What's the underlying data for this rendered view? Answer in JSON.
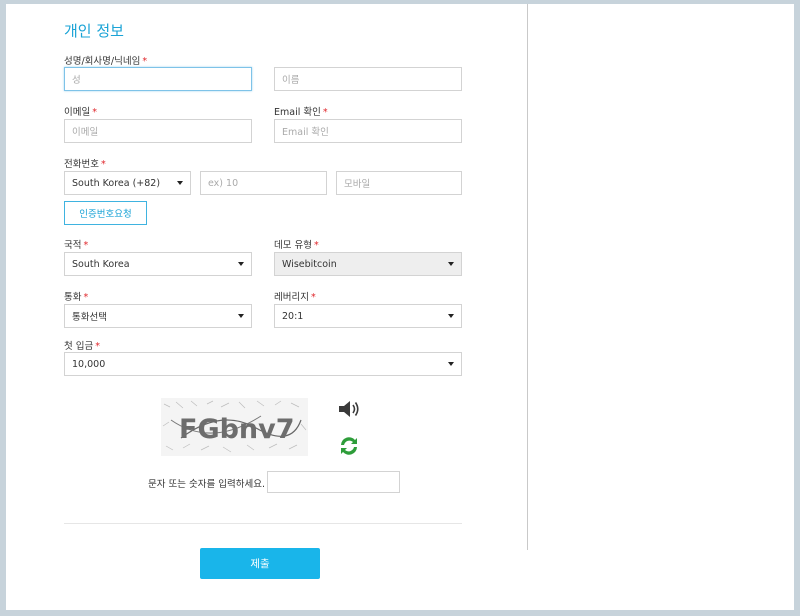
{
  "form": {
    "title": "개인 정보",
    "last_name": {
      "label": "성명/회사명/닉네임",
      "placeholder": "성"
    },
    "first_name": {
      "placeholder": "이름"
    },
    "email": {
      "label": "이메일",
      "placeholder": "이메일"
    },
    "email_confirm": {
      "label": "Email 확인",
      "placeholder": "Email 확인"
    },
    "phone": {
      "label": "전화번호",
      "country_code": "South Korea (+82)",
      "area_placeholder": "ex) 10",
      "mobile_placeholder": "모바일",
      "verify_button": "인증번호요청"
    },
    "nationality": {
      "label": "국적",
      "value": "South Korea"
    },
    "demo_type": {
      "label": "데모 유형",
      "value": "Wisebitcoin"
    },
    "currency": {
      "label": "통화",
      "value": "통화선택"
    },
    "leverage": {
      "label": "레버리지",
      "value": "20:1"
    },
    "first_deposit": {
      "label": "첫 입금",
      "value": "10,000"
    },
    "required_mark": "*",
    "captcha": {
      "text": "FGbnv7",
      "input_label": "문자 또는 숫자를 입력하세요.",
      "audio_icon": "speaker-icon",
      "refresh_icon": "refresh-icon"
    },
    "submit_label": "제출"
  },
  "colors": {
    "accent": "#1aa3d6",
    "required": "#e0262b",
    "submit_bg": "#19b5ea",
    "page_bg": "#c7d3db"
  }
}
